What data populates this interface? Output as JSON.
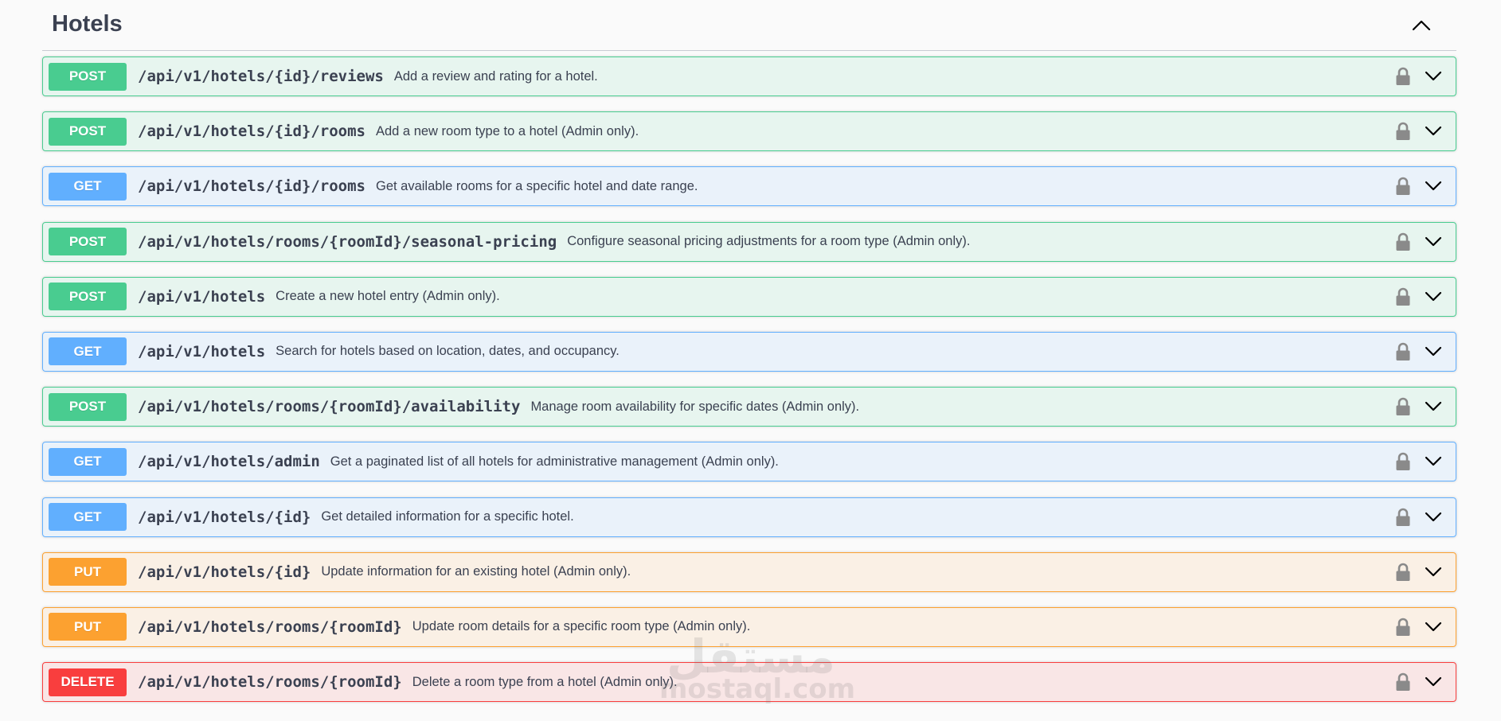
{
  "section": {
    "title": "Hotels"
  },
  "operations": [
    {
      "method": "POST",
      "path": "/api/v1/hotels/{id}/reviews",
      "summary": "Add a review and rating for a hotel."
    },
    {
      "method": "POST",
      "path": "/api/v1/hotels/{id}/rooms",
      "summary": "Add a new room type to a hotel (Admin only)."
    },
    {
      "method": "GET",
      "path": "/api/v1/hotels/{id}/rooms",
      "summary": "Get available rooms for a specific hotel and date range."
    },
    {
      "method": "POST",
      "path": "/api/v1/hotels/rooms/{roomId}/seasonal-pricing",
      "summary": "Configure seasonal pricing adjustments for a room type (Admin only)."
    },
    {
      "method": "POST",
      "path": "/api/v1/hotels",
      "summary": "Create a new hotel entry (Admin only)."
    },
    {
      "method": "GET",
      "path": "/api/v1/hotels",
      "summary": "Search for hotels based on location, dates, and occupancy."
    },
    {
      "method": "POST",
      "path": "/api/v1/hotels/rooms/{roomId}/availability",
      "summary": "Manage room availability for specific dates (Admin only)."
    },
    {
      "method": "GET",
      "path": "/api/v1/hotels/admin",
      "summary": "Get a paginated list of all hotels for administrative management (Admin only)."
    },
    {
      "method": "GET",
      "path": "/api/v1/hotels/{id}",
      "summary": "Get detailed information for a specific hotel."
    },
    {
      "method": "PUT",
      "path": "/api/v1/hotels/{id}",
      "summary": "Update information for an existing hotel (Admin only)."
    },
    {
      "method": "PUT",
      "path": "/api/v1/hotels/rooms/{roomId}",
      "summary": "Update room details for a specific room type (Admin only)."
    },
    {
      "method": "DELETE",
      "path": "/api/v1/hotels/rooms/{roomId}",
      "summary": "Delete a room type from a hotel (Admin only)."
    }
  ],
  "icons": {
    "section_toggle": "chevron-up-icon",
    "lock": "lock-icon",
    "expand": "chevron-down-icon"
  },
  "colors": {
    "post": "#49cc90",
    "get": "#61affe",
    "put": "#fca130",
    "delete": "#f93e3e",
    "text": "#3b4151"
  },
  "watermark": {
    "arabic": "مستقل",
    "latin": "mostaql.com"
  }
}
